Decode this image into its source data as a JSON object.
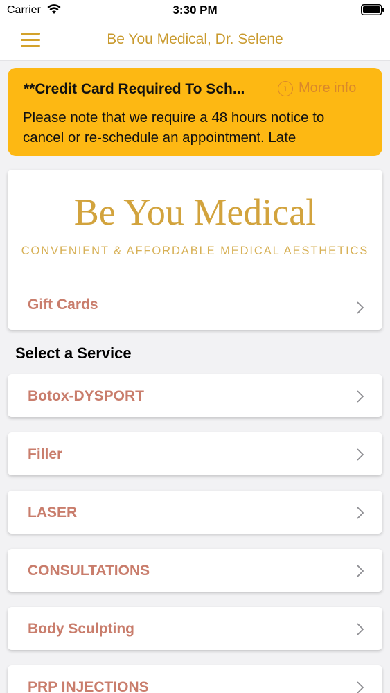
{
  "status_bar": {
    "carrier": "Carrier",
    "time": "3:30 PM",
    "icons": [
      "wifi-icon",
      "battery-icon"
    ]
  },
  "nav": {
    "title": "Be You Medical, Dr. Selene",
    "menu_icon": "hamburger-menu-icon"
  },
  "notice": {
    "title": "**Credit Card Required To Sch...",
    "more_info_label": "More info",
    "body": "Please note that we require a 48 hours notice to cancel or re-schedule an appointment. Late",
    "background_color": "#fdb813"
  },
  "brand": {
    "name": "Be You Medical",
    "tagline": "CONVENIENT & AFFORDABLE MEDICAL AESTHETICS",
    "gift_cards_label": "Gift Cards",
    "gold_color": "#d2a33d"
  },
  "services": {
    "section_title": "Select a Service",
    "items": [
      {
        "label": "Botox-DYSPORT"
      },
      {
        "label": "Filler"
      },
      {
        "label": "LASER"
      },
      {
        "label": "CONSULTATIONS"
      },
      {
        "label": "Body Sculpting"
      },
      {
        "label": "PRP INJECTIONS"
      }
    ],
    "label_color": "#c97d6c"
  }
}
